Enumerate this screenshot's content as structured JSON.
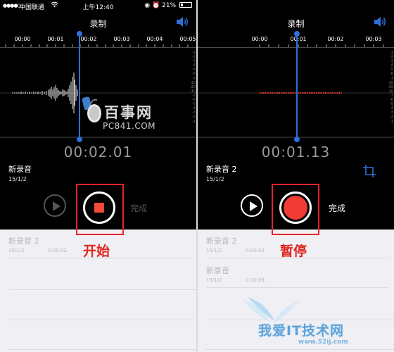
{
  "status_bar": {
    "carrier": "中国联通",
    "time": "上午12:40",
    "battery": "21%"
  },
  "left": {
    "title": "录制",
    "timeline_labels": [
      "00:00",
      "00:01",
      "00:02",
      "00:03",
      "00:04",
      "00:05"
    ],
    "db_scale": [
      "-1",
      "-2",
      "-3",
      "-4",
      "-5",
      "-6",
      "-7",
      "-10",
      "-20",
      "-10",
      "-7",
      "-6",
      "-5",
      "-4",
      "-3",
      "-2",
      "-1"
    ],
    "elapsed": "00:02.01",
    "recording_name": "新录音",
    "recording_date": "15/1/2",
    "record_state": "recording (stop icon shown)",
    "done_label": "完成",
    "caption": "开始",
    "list": [
      {
        "name": "新录音 2",
        "date": "15/1/2",
        "duration": "0:00:02"
      }
    ]
  },
  "right": {
    "title": "录制",
    "timeline_labels": [
      "00:00",
      "00:01",
      "00:02",
      "00:03"
    ],
    "db_scale": [
      "-1",
      "-2",
      "-3",
      "-4",
      "-5",
      "-6",
      "-7",
      "-10",
      "-20",
      "-10",
      "-7",
      "-6",
      "-5",
      "-4",
      "-3",
      "-2",
      "-1"
    ],
    "elapsed": "00:01.13",
    "recording_name": "新录音 2",
    "recording_date": "15/1/2",
    "record_state": "paused (record dot shown)",
    "done_label": "完成",
    "caption": "暂停",
    "list": [
      {
        "name": "新录音 2",
        "date": "15/1/2",
        "duration": "0:00:03"
      },
      {
        "name": "新录音",
        "date": "15/1/2",
        "duration": "0:00:09"
      }
    ]
  },
  "watermarks": {
    "baishi_text": "百事网",
    "baishi_url": "PC841.COM",
    "woai_text": "我爱IT技术网",
    "woai_url": "www.52ij.com"
  },
  "colors": {
    "accent_blue": "#2f6fdc",
    "record_red": "#f03c34",
    "highlight_red": "#e6242b"
  }
}
